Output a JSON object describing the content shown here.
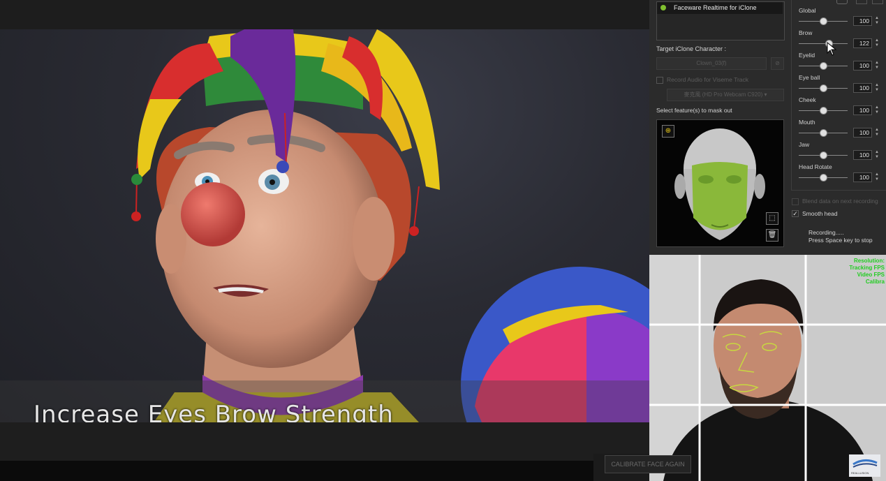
{
  "subtitle": "Increase Eyes Brow Strength",
  "device": {
    "name": "Faceware Realtime for iClone",
    "status_color": "#7fbf2f"
  },
  "target": {
    "label": "Target iClone Character :",
    "character": "Clown_03(f)",
    "record_audio_label": "Record Audio for Viseme Track",
    "audio_device": "麥克風 (HD Pro Webcam C920)"
  },
  "mask": {
    "label": "Select feature(s) to mask out"
  },
  "sliders": [
    {
      "label": "Global",
      "value": "100",
      "level": 0.5
    },
    {
      "label": "Brow",
      "value": "122",
      "level": 0.61
    },
    {
      "label": "Eyelid",
      "value": "100",
      "level": 0.5
    },
    {
      "label": "Eye ball",
      "value": "100",
      "level": 0.5
    },
    {
      "label": "Cheek",
      "value": "100",
      "level": 0.5
    },
    {
      "label": "Mouth",
      "value": "100",
      "level": 0.5
    },
    {
      "label": "Jaw",
      "value": "100",
      "level": 0.5
    },
    {
      "label": "Head Rotate",
      "value": "100",
      "level": 0.5
    }
  ],
  "options": {
    "blend_label": "Blend data on next recording",
    "smooth_head_label": "Smooth head",
    "smooth_head_checked": true
  },
  "recording": {
    "line1": "Recording.....",
    "line2": "Press Space key to stop"
  },
  "webcam_stats": [
    "Resolution:",
    "Tracking FPS",
    "Video FPS",
    "Calibra"
  ],
  "calibrate_button": "CALIBRATE FACE AGAIN",
  "logo_text": "REALLUSION"
}
